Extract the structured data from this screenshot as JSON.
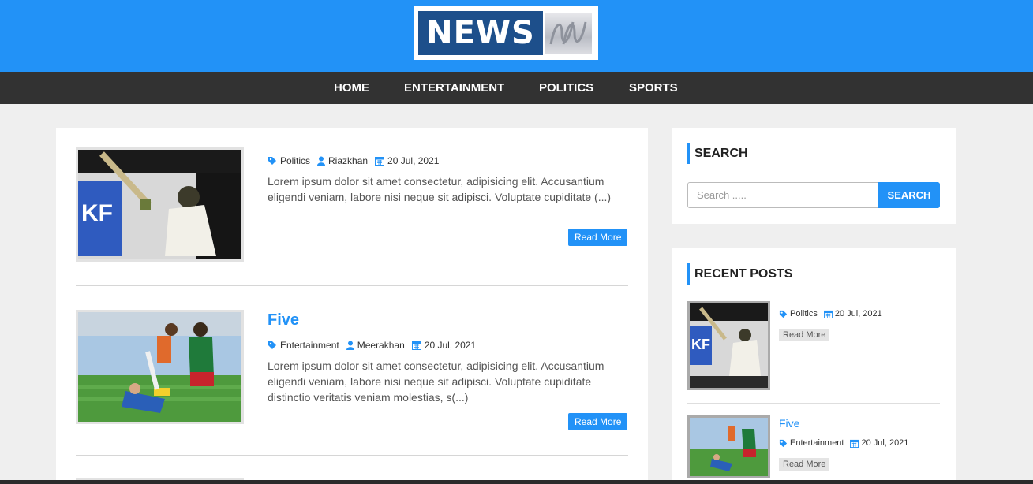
{
  "logo": {
    "text": "NEWS",
    "alt": "ABC"
  },
  "nav": [
    {
      "label": "HOME"
    },
    {
      "label": "ENTERTAINMENT"
    },
    {
      "label": "POLITICS"
    },
    {
      "label": "SPORTS"
    }
  ],
  "posts": [
    {
      "title": "",
      "image": "cricket-batsman",
      "category": "Politics",
      "author": "Riazkhan",
      "date": "20 Jul, 2021",
      "excerpt": "Lorem ipsum dolor sit amet consectetur, adipisicing elit. Accusantium eligendi veniam, labore nisi neque sit adipisci. Voluptate cupiditate (...)",
      "read_more": "Read More"
    },
    {
      "title": "Five",
      "image": "football-tackle",
      "category": "Entertainment",
      "author": "Meerakhan",
      "date": "20 Jul, 2021",
      "excerpt": "Lorem ipsum dolor sit amet consectetur, adipisicing elit. Accusantium eligendi veniam, labore nisi neque sit adipisci. Voluptate cupiditate distinctio veritatis veniam molestias, s(...)",
      "read_more": "Read More"
    }
  ],
  "sidebar": {
    "search": {
      "title": "SEARCH",
      "placeholder": "Search .....",
      "button": "SEARCH"
    },
    "recent": {
      "title": "RECENT POSTS",
      "items": [
        {
          "title": "",
          "image": "cricket-batsman",
          "category": "Politics",
          "date": "20 Jul, 2021",
          "read_more": "Read More"
        },
        {
          "title": "Five",
          "image": "football-tackle",
          "category": "Entertainment",
          "date": "20 Jul, 2021",
          "read_more": "Read More"
        }
      ]
    }
  },
  "colors": {
    "brand_blue": "#2292f7",
    "nav_dark": "#323232",
    "logo_navy": "#1d4f8b",
    "page_bg": "#efefef"
  }
}
